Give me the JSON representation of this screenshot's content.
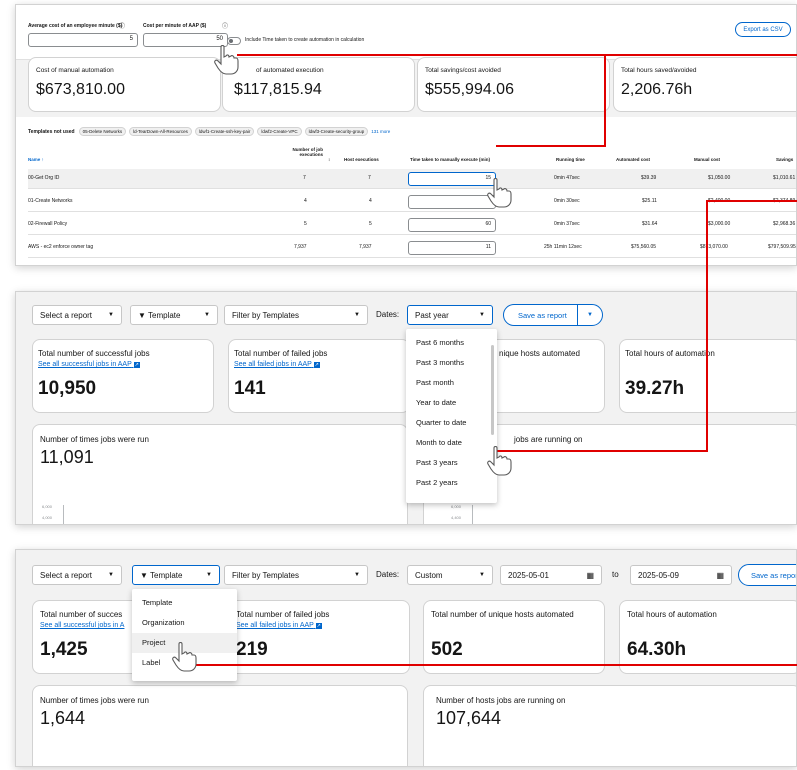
{
  "shot1": {
    "labels": {
      "avg_cost": "Average cost of an employee minute ($)",
      "cost_per_min": "Cost per minute of AAP ($)",
      "toggle_label": "Include Time taken to create automation in calculation",
      "export": "Export as CSV"
    },
    "inputs": {
      "avg_cost_value": "5",
      "cost_per_min_value": "50"
    },
    "cards": [
      {
        "label": "Cost of manual automation",
        "value": "$673,810.00"
      },
      {
        "label": "of automated execution",
        "value": "$117,815.94"
      },
      {
        "label": "Total savings/cost avoided",
        "value": "$555,994.06"
      },
      {
        "label": "Total hours saved/avoided",
        "value": "2,206.76h"
      }
    ],
    "templates_not_used_label": "Templates not used",
    "chips": [
      "05-Delete Networks",
      "ld-TearDown-All-Resources",
      "ldwf1-Create-ssh-key-pair",
      "ldwf2-Create-VPC",
      "ldwf3-Create-security-group"
    ],
    "more_label": "131 more",
    "table": {
      "headers": {
        "name": "Name",
        "job_exec_1": "Number of job",
        "job_exec_2": "executions",
        "host_exec": "Host executions",
        "time_taken": "Time taken to manually execute (min)",
        "running": "Running time",
        "automated_cost": "Automated cost",
        "manual_cost": "Manual cost",
        "savings": "Savings"
      },
      "rows": [
        {
          "name": "00-Get Org ID",
          "jobs": "7",
          "hosts": "7",
          "time": "15",
          "running": "0min 47sec",
          "auto": "$39.39",
          "manual": "$1,050.00",
          "savings": "$1,010.61"
        },
        {
          "name": "01-Create Networks",
          "jobs": "4",
          "hosts": "4",
          "time": "",
          "running": "0min 30sec",
          "auto": "$25.11",
          "manual": "$2,400.00",
          "savings": "$2,374.89"
        },
        {
          "name": "02-Firewall Policy",
          "jobs": "5",
          "hosts": "5",
          "time": "60",
          "running": "0min 37sec",
          "auto": "$31.64",
          "manual": "$3,000.00",
          "savings": "$2,968.36"
        },
        {
          "name": "AWS - ec2 enforce owner tag",
          "jobs": "7,937",
          "hosts": "7,937",
          "time": "11",
          "running": "25h 11min 12sec",
          "auto": "$75,560.05",
          "manual": "$873,070.00",
          "savings": "$797,509.95"
        }
      ]
    }
  },
  "shot2": {
    "toolbar": {
      "select_report": "Select a report",
      "template": "Template",
      "filter": "Filter by Templates",
      "dates_label": "Dates:",
      "dates_value": "Past year",
      "save_report": "Save as report"
    },
    "dropdown": [
      "Past 6 months",
      "Past 3 months",
      "Past month",
      "Year to date",
      "Quarter to date",
      "Month to date",
      "Past 3 years",
      "Past 2 years"
    ],
    "cards": [
      {
        "label": "Total number of successful jobs",
        "link": "See all successful jobs in AAP",
        "value": "10,950"
      },
      {
        "label": "Total number of failed jobs",
        "link": "See all failed jobs in AAP",
        "value": "141"
      },
      {
        "label": "nique hosts automated",
        "value": ""
      },
      {
        "label": "Total hours of automation",
        "value": "39.27h"
      }
    ],
    "runs_label": "Number of times jobs were run",
    "runs_value": "11,091",
    "hosts_label": "jobs are running on",
    "axis_left": [
      "6,000",
      "4,000"
    ],
    "axis_right": [
      "6,000",
      "4,400"
    ]
  },
  "shot3": {
    "toolbar": {
      "select_report": "Select a report",
      "template": "Template",
      "filter": "Filter by Templates",
      "dates_label": "Dates:",
      "dates_value": "Custom",
      "from": "2025-05-01",
      "to_label": "to",
      "to": "2025-05-09",
      "save_report": "Save as report"
    },
    "dropdown": [
      "Template",
      "Organization",
      "Project",
      "Label"
    ],
    "cards": [
      {
        "label": "Total number of succes",
        "link": "See all successful jobs in A",
        "value": "1,425"
      },
      {
        "label": "Total number of failed jobs",
        "link": "See all failed jobs in AAP",
        "value": "219"
      },
      {
        "label": "Total number of unique hosts automated",
        "value": "502"
      },
      {
        "label": "Total hours of automation",
        "value": "64.30h"
      }
    ],
    "runs_label": "Number of times jobs were run",
    "runs_value": "1,644",
    "hosts_label": "Number of hosts jobs are running on",
    "hosts_value": "107,644"
  },
  "colors": {
    "accent": "#0066cc",
    "annotation": "#e00000",
    "panel_bg": "#f2f2f2"
  }
}
